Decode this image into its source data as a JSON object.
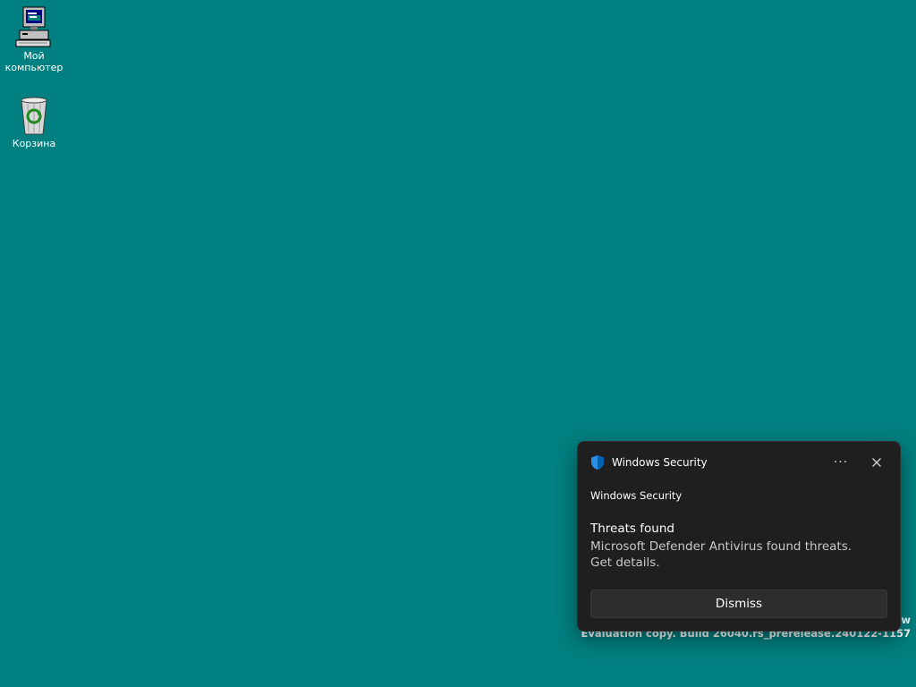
{
  "desktop": {
    "background_color": "#008080",
    "icons": [
      {
        "label": "Мой компьютер",
        "icon": "my-computer-icon"
      },
      {
        "label": "Корзина",
        "icon": "recycle-bin-icon"
      }
    ]
  },
  "watermark": {
    "line1_fragment": "ew",
    "line2": "Evaluation copy. Build 26040.rs_prerelease.240122-1157"
  },
  "notification": {
    "app_name": "Windows Security",
    "app_icon": "shield-icon",
    "more_label": "···",
    "close_label": "✕",
    "attribution": "Windows Security",
    "title": "Threats found",
    "body": "Microsoft Defender Antivirus found threats. Get details.",
    "dismiss_label": "Dismiss",
    "background_color": "#1f1f1f",
    "accent_color": "#0078d4"
  }
}
